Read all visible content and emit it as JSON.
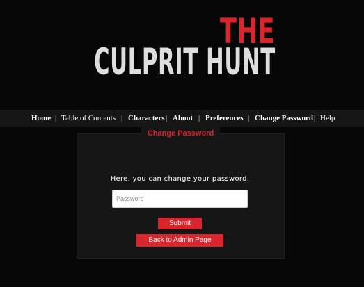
{
  "logo": {
    "line1": "THE",
    "line2": "CULPRIT HUNT"
  },
  "nav": {
    "separator": "|",
    "items": [
      {
        "label": "Home"
      },
      {
        "label": "Table of Contents"
      },
      {
        "label": "Characters"
      },
      {
        "label": "About"
      },
      {
        "label": "Preferences"
      },
      {
        "label": "Change Password"
      },
      {
        "label": "Help"
      }
    ]
  },
  "panel": {
    "title": "Change Password",
    "instruction": "Here, you can change your password.",
    "password_placeholder": "Password",
    "password_value": "",
    "submit_label": "Submit",
    "back_label": "Back to Admin Page"
  },
  "colors": {
    "accent": "#d8262c",
    "background": "#070707",
    "panel": "#161616"
  }
}
